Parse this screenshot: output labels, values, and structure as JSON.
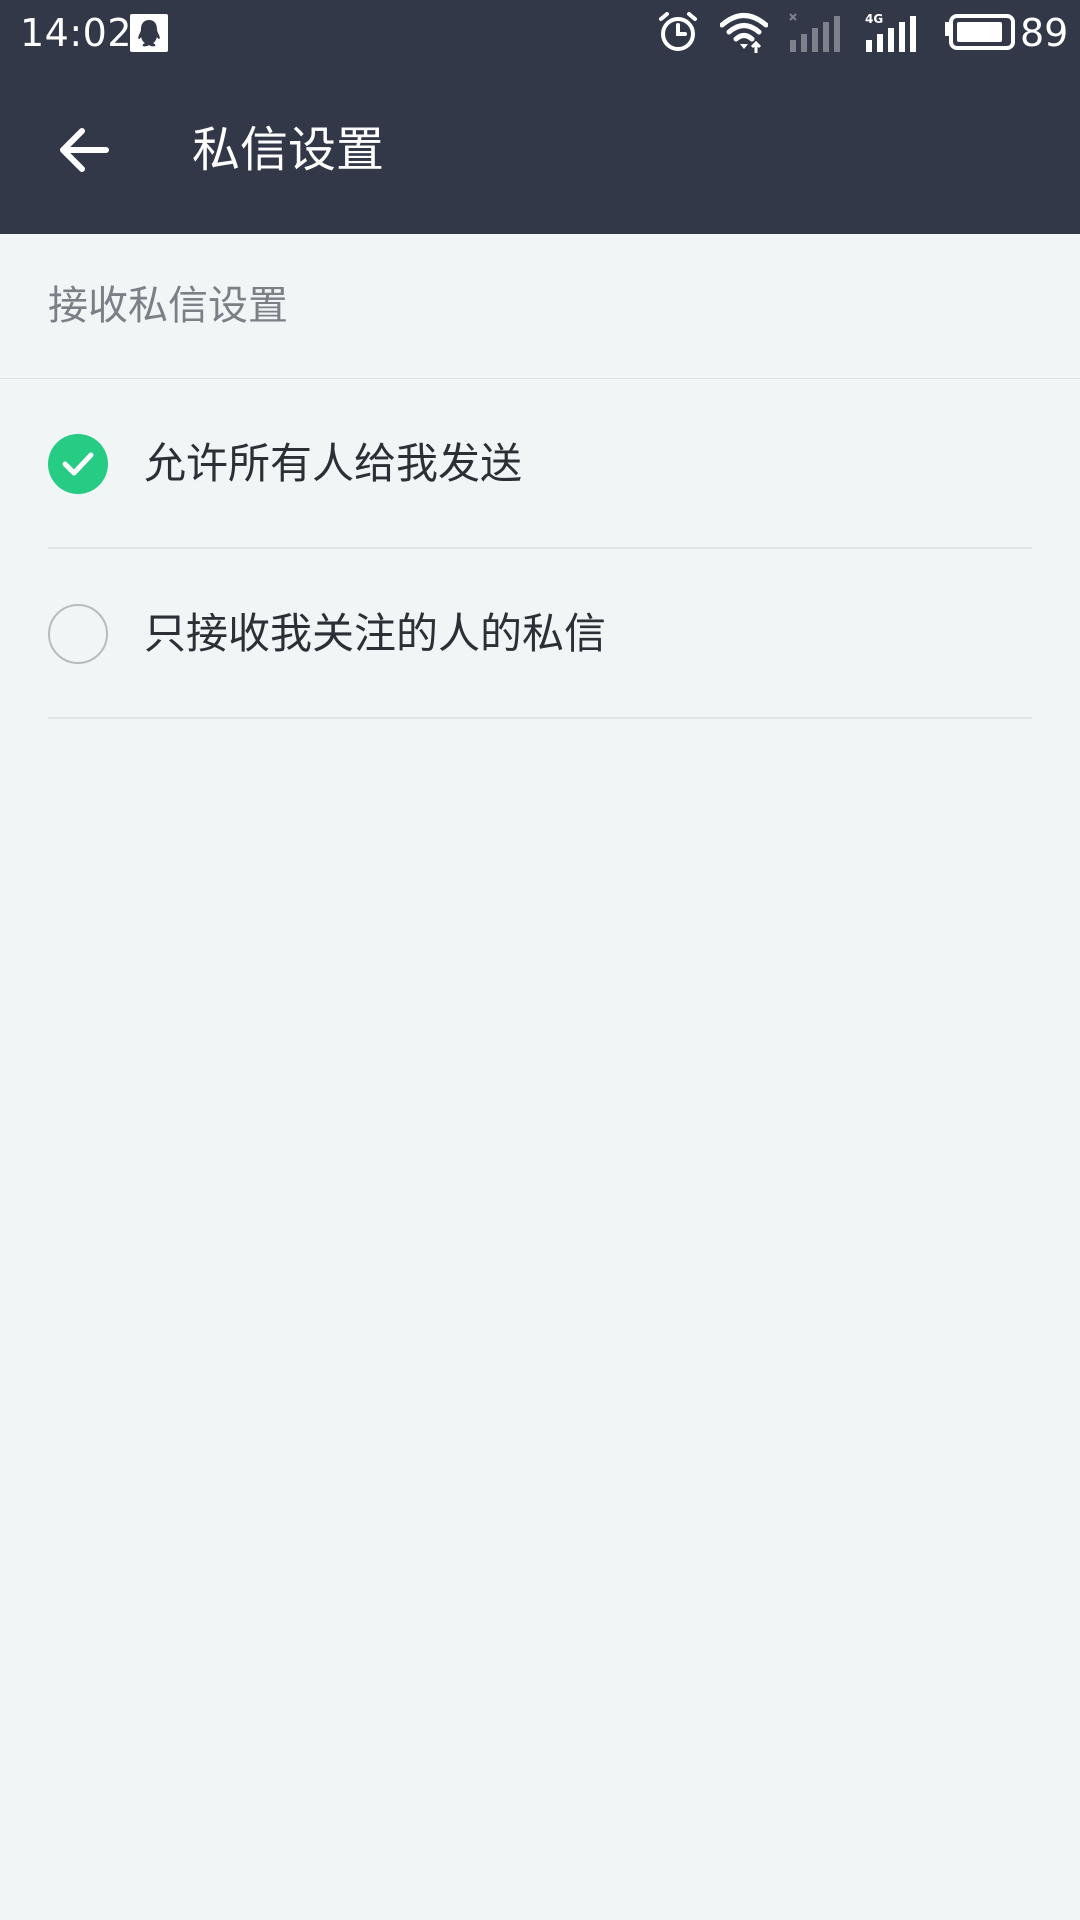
{
  "status_bar": {
    "time": "14:02",
    "battery_percent": "89",
    "battery_level": 0.89,
    "icons": [
      "qq-icon",
      "alarm-icon",
      "wifi-icon",
      "sim1-signal-icon",
      "sim2-4g-signal-icon",
      "battery-icon"
    ],
    "network_label": "4G"
  },
  "app_bar": {
    "back_icon": "arrow-left-icon",
    "title": "私信设置"
  },
  "section": {
    "header": "接收私信设置",
    "options": [
      {
        "label": "允许所有人给我发送",
        "selected": true
      },
      {
        "label": "只接收我关注的人的私信",
        "selected": false
      }
    ]
  },
  "colors": {
    "header_bg": "#333849",
    "page_bg": "#f1f5f6",
    "accent": "#26cb84"
  }
}
